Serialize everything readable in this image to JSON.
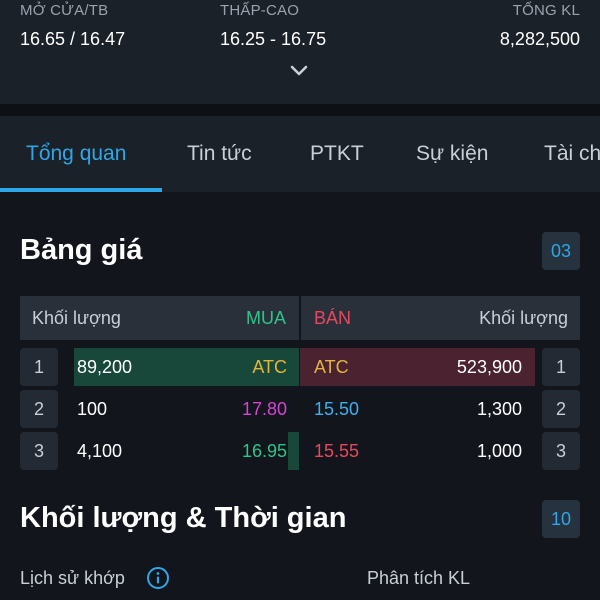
{
  "stats": [
    {
      "label": "MỞ CỬA/TB",
      "value": "16.65 / 16.47"
    },
    {
      "label": "THẤP-CAO",
      "value": "16.25 - 16.75"
    },
    {
      "label": "TỔNG KL",
      "value": "8,282,500"
    }
  ],
  "tabs": [
    "Tổng quan",
    "Tin tức",
    "PTKT",
    "Sự kiện",
    "Tài ch"
  ],
  "active_tab": "Tổng quan",
  "price_board": {
    "title": "Bảng giá",
    "badge": "03",
    "headers": {
      "buy_volume": "Khối lượng",
      "buy": "MUA",
      "sell": "BÁN",
      "sell_volume": "Khối lượng"
    },
    "rows": [
      {
        "index": "1",
        "buy_volume": "89,200",
        "buy_price": "ATC",
        "sell_price": "ATC",
        "sell_volume": "523,900",
        "buy_fill": 1.0,
        "sell_fill": 1.0
      },
      {
        "index": "2",
        "buy_volume": "100",
        "buy_price": "17.80",
        "sell_price": "15.50",
        "sell_volume": "1,300",
        "buy_fill": 0.0,
        "sell_fill": 0.0
      },
      {
        "index": "3",
        "buy_volume": "4,100",
        "buy_price": "16.95",
        "sell_price": "15.55",
        "sell_volume": "1,000",
        "buy_fill": 0.05,
        "sell_fill": 0.0
      }
    ],
    "colors": {
      "buy": "#2bc48a",
      "sell": "#e8485f",
      "ceiling": "#d542d5",
      "floor": "#3bb0ef",
      "reference": "#e2b53c",
      "accent": "#2fa6e6"
    }
  },
  "volume_time": {
    "title": "Khối lượng & Thời gian",
    "badge": "10",
    "history_label": "Lịch sử khớp",
    "analysis_label": "Phân tích KL"
  }
}
